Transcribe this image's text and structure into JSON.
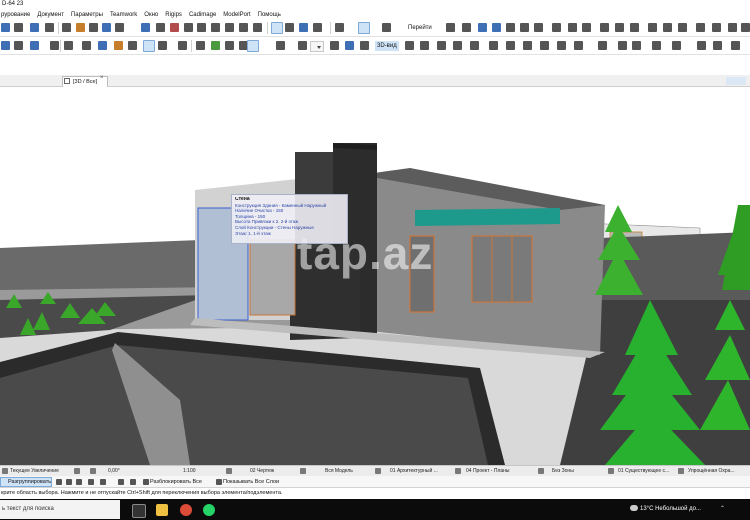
{
  "window": {
    "title": "D-64 23"
  },
  "menu": [
    "рурование",
    "Документ",
    "Параметры",
    "Teamwork",
    "Окно",
    "Rigips",
    "Cadimage",
    "ModelPort",
    "Помощь"
  ],
  "toolbar": {
    "go_label": "Перейти",
    "view3d_label": "3D-вид"
  },
  "tab": {
    "label": "[3D / Все]",
    "close": "×"
  },
  "tooltip": {
    "title": "Стена",
    "lines": [
      "Конструкция Здания - Каменный Наружный",
      "Наличие Очистка - 150",
      "Толщина - 150",
      "Высота Привязки к 2. 2-й этаж",
      "Слой Конструкции - Стены Наружные",
      "Этаж: 1. 1-й этаж"
    ]
  },
  "watermark": "tap.az",
  "status": {
    "zoom": "Текущее Увеличение",
    "angle": "0,00°",
    "scale": "1:100",
    "sheet": "02 Чертеж",
    "model": "Вся Модель",
    "arch": "01 Архитектурный ...",
    "plan": "04 Проект - Планы",
    "zones": "Без Зоны",
    "existing": "01 Существующее с...",
    "simplified": "Упрощённая Охра..."
  },
  "status2": {
    "ungroup": "Разгруппировать",
    "unlock_all": "Разблокировать Все",
    "show_layers": "Показывать Все Слои"
  },
  "hint": "крите область выбора. Нажмите и не отпускайте Ctrl+Shift для переключения выбора элемента/подэлемента.",
  "taskbar": {
    "search": "ь текст для поиска",
    "temperature": "13°C",
    "weather": "Небольшой до..."
  },
  "colors": {
    "toolbar_highlight": "#cfe3f7",
    "roof_accent": "#1e9a8c",
    "grass": "#3aa72b",
    "taskbar": "#0b0b0b"
  }
}
